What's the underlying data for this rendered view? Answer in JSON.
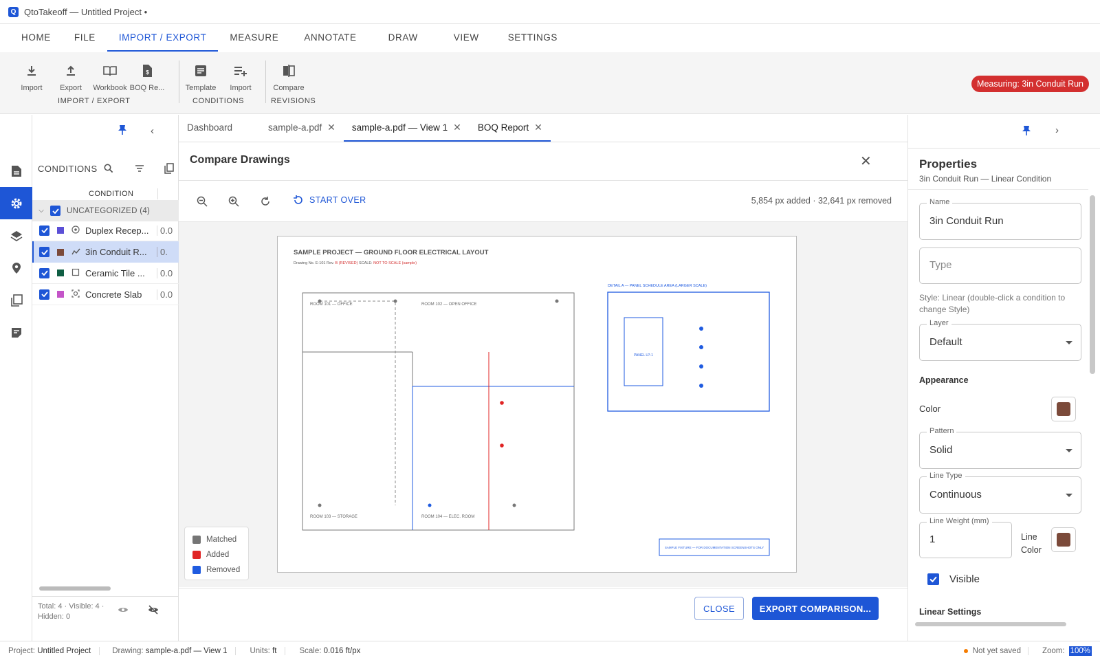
{
  "app": {
    "title": "QtoTakeoff — Untitled Project •",
    "logo_letter": "Q"
  },
  "menu": [
    "HOME",
    "FILE",
    "IMPORT / EXPORT",
    "MEASURE",
    "ANNOTATE",
    "DRAW",
    "VIEW",
    "SETTINGS"
  ],
  "ribbon": {
    "import_export": {
      "buttons": [
        "Import",
        "Export",
        "Workbook",
        "BOQ Re..."
      ],
      "group_label": "IMPORT / EXPORT"
    },
    "conditions": {
      "buttons": [
        "Template",
        "Import"
      ],
      "group_label": "CONDITIONS"
    },
    "revisions": {
      "buttons": [
        "Compare"
      ],
      "group_label": "REVISIONS"
    },
    "measuring_badge": "Measuring: 3in Conduit Run"
  },
  "conditions_panel": {
    "title": "CONDITIONS",
    "column_header": "CONDITION",
    "group": "UNCATEGORIZED (4)",
    "items": [
      {
        "label": "Duplex Recep...",
        "value": "0.0",
        "color": "#5b4fd6",
        "icon": "point-icon"
      },
      {
        "label": "3in Conduit R...",
        "value": "0.",
        "color": "#7b4a3a",
        "icon": "linear-icon"
      },
      {
        "label": "Ceramic Tile ...",
        "value": "0.0",
        "color": "#0f5e44",
        "icon": "area-icon"
      },
      {
        "label": "Concrete Slab",
        "value": "0.0",
        "color": "#c454c8",
        "icon": "volume-icon"
      }
    ],
    "footer_line1": "Total: 4 · Visible: 4 ·",
    "footer_line2": "Hidden: 0"
  },
  "doc_tabs": [
    {
      "label": "Dashboard",
      "closable": false
    },
    {
      "label": "sample-a.pdf",
      "closable": true
    },
    {
      "label": "sample-a.pdf — View 1",
      "closable": true
    },
    {
      "label": "BOQ Report",
      "closable": true
    }
  ],
  "compare": {
    "title": "Compare Drawings",
    "start_over": "START OVER",
    "stats": "5,854 px added · 32,641 px removed",
    "legend": [
      "Matched",
      "Added",
      "Removed"
    ],
    "legend_colors": {
      "matched": "#757575",
      "added": "#e02424",
      "removed": "#1f5be0"
    },
    "close_button": "CLOSE",
    "export_button": "EXPORT COMPARISON..."
  },
  "drawing": {
    "title": "SAMPLE PROJECT — GROUND FLOOR ELECTRICAL LAYOUT",
    "subtitle_a": "Drawing No. E-101   Rev. ",
    "subtitle_b": "B (REVISED)",
    "subtitle_c": "   SCALE: ",
    "subtitle_d": "NOT TO SCALE (sample)",
    "room101": "ROOM 101  —  OFFICE",
    "room102": "ROOM 102  —  OPEN OFFICE",
    "room103": "ROOM 103 — STORAGE",
    "room104": "ROOM 104 — ELEC. ROOM",
    "detail": "DETAIL A — PANEL SCHEDULE AREA (LARGER SCALE)",
    "panel": "PANEL LP-1",
    "note": "SAMPLE FIXTURE — FOR DOCUMENTATION SCREENSHOTS ONLY"
  },
  "properties": {
    "title": "Properties",
    "subtitle": "3in Conduit Run — Linear Condition",
    "name_label": "Name",
    "name_value": "3in Conduit Run",
    "type_placeholder": "Type",
    "style_hint": "Style: Linear (double-click a condition to change Style)",
    "layer_label": "Layer",
    "layer_value": "Default",
    "appearance": "Appearance",
    "color_label": "Color",
    "color": "#7b4a3a",
    "pattern_label": "Pattern",
    "pattern_value": "Solid",
    "line_type_label": "Line Type",
    "line_type_value": "Continuous",
    "line_weight_label": "Line Weight (mm)",
    "line_weight_value": "1",
    "line_color_label_1": "Line",
    "line_color_label_2": "Color",
    "visible_label": "Visible",
    "linear_settings": "Linear Settings"
  },
  "status": {
    "project_label": "Project:",
    "project": "Untitled Project",
    "drawing_label": "Drawing:",
    "drawing": "sample-a.pdf — View 1",
    "units_label": "Units:",
    "units": "ft",
    "scale_label": "Scale:",
    "scale": "0.016 ft/px",
    "saved": "Not yet saved",
    "zoom_label": "Zoom:",
    "zoom": "100%"
  }
}
